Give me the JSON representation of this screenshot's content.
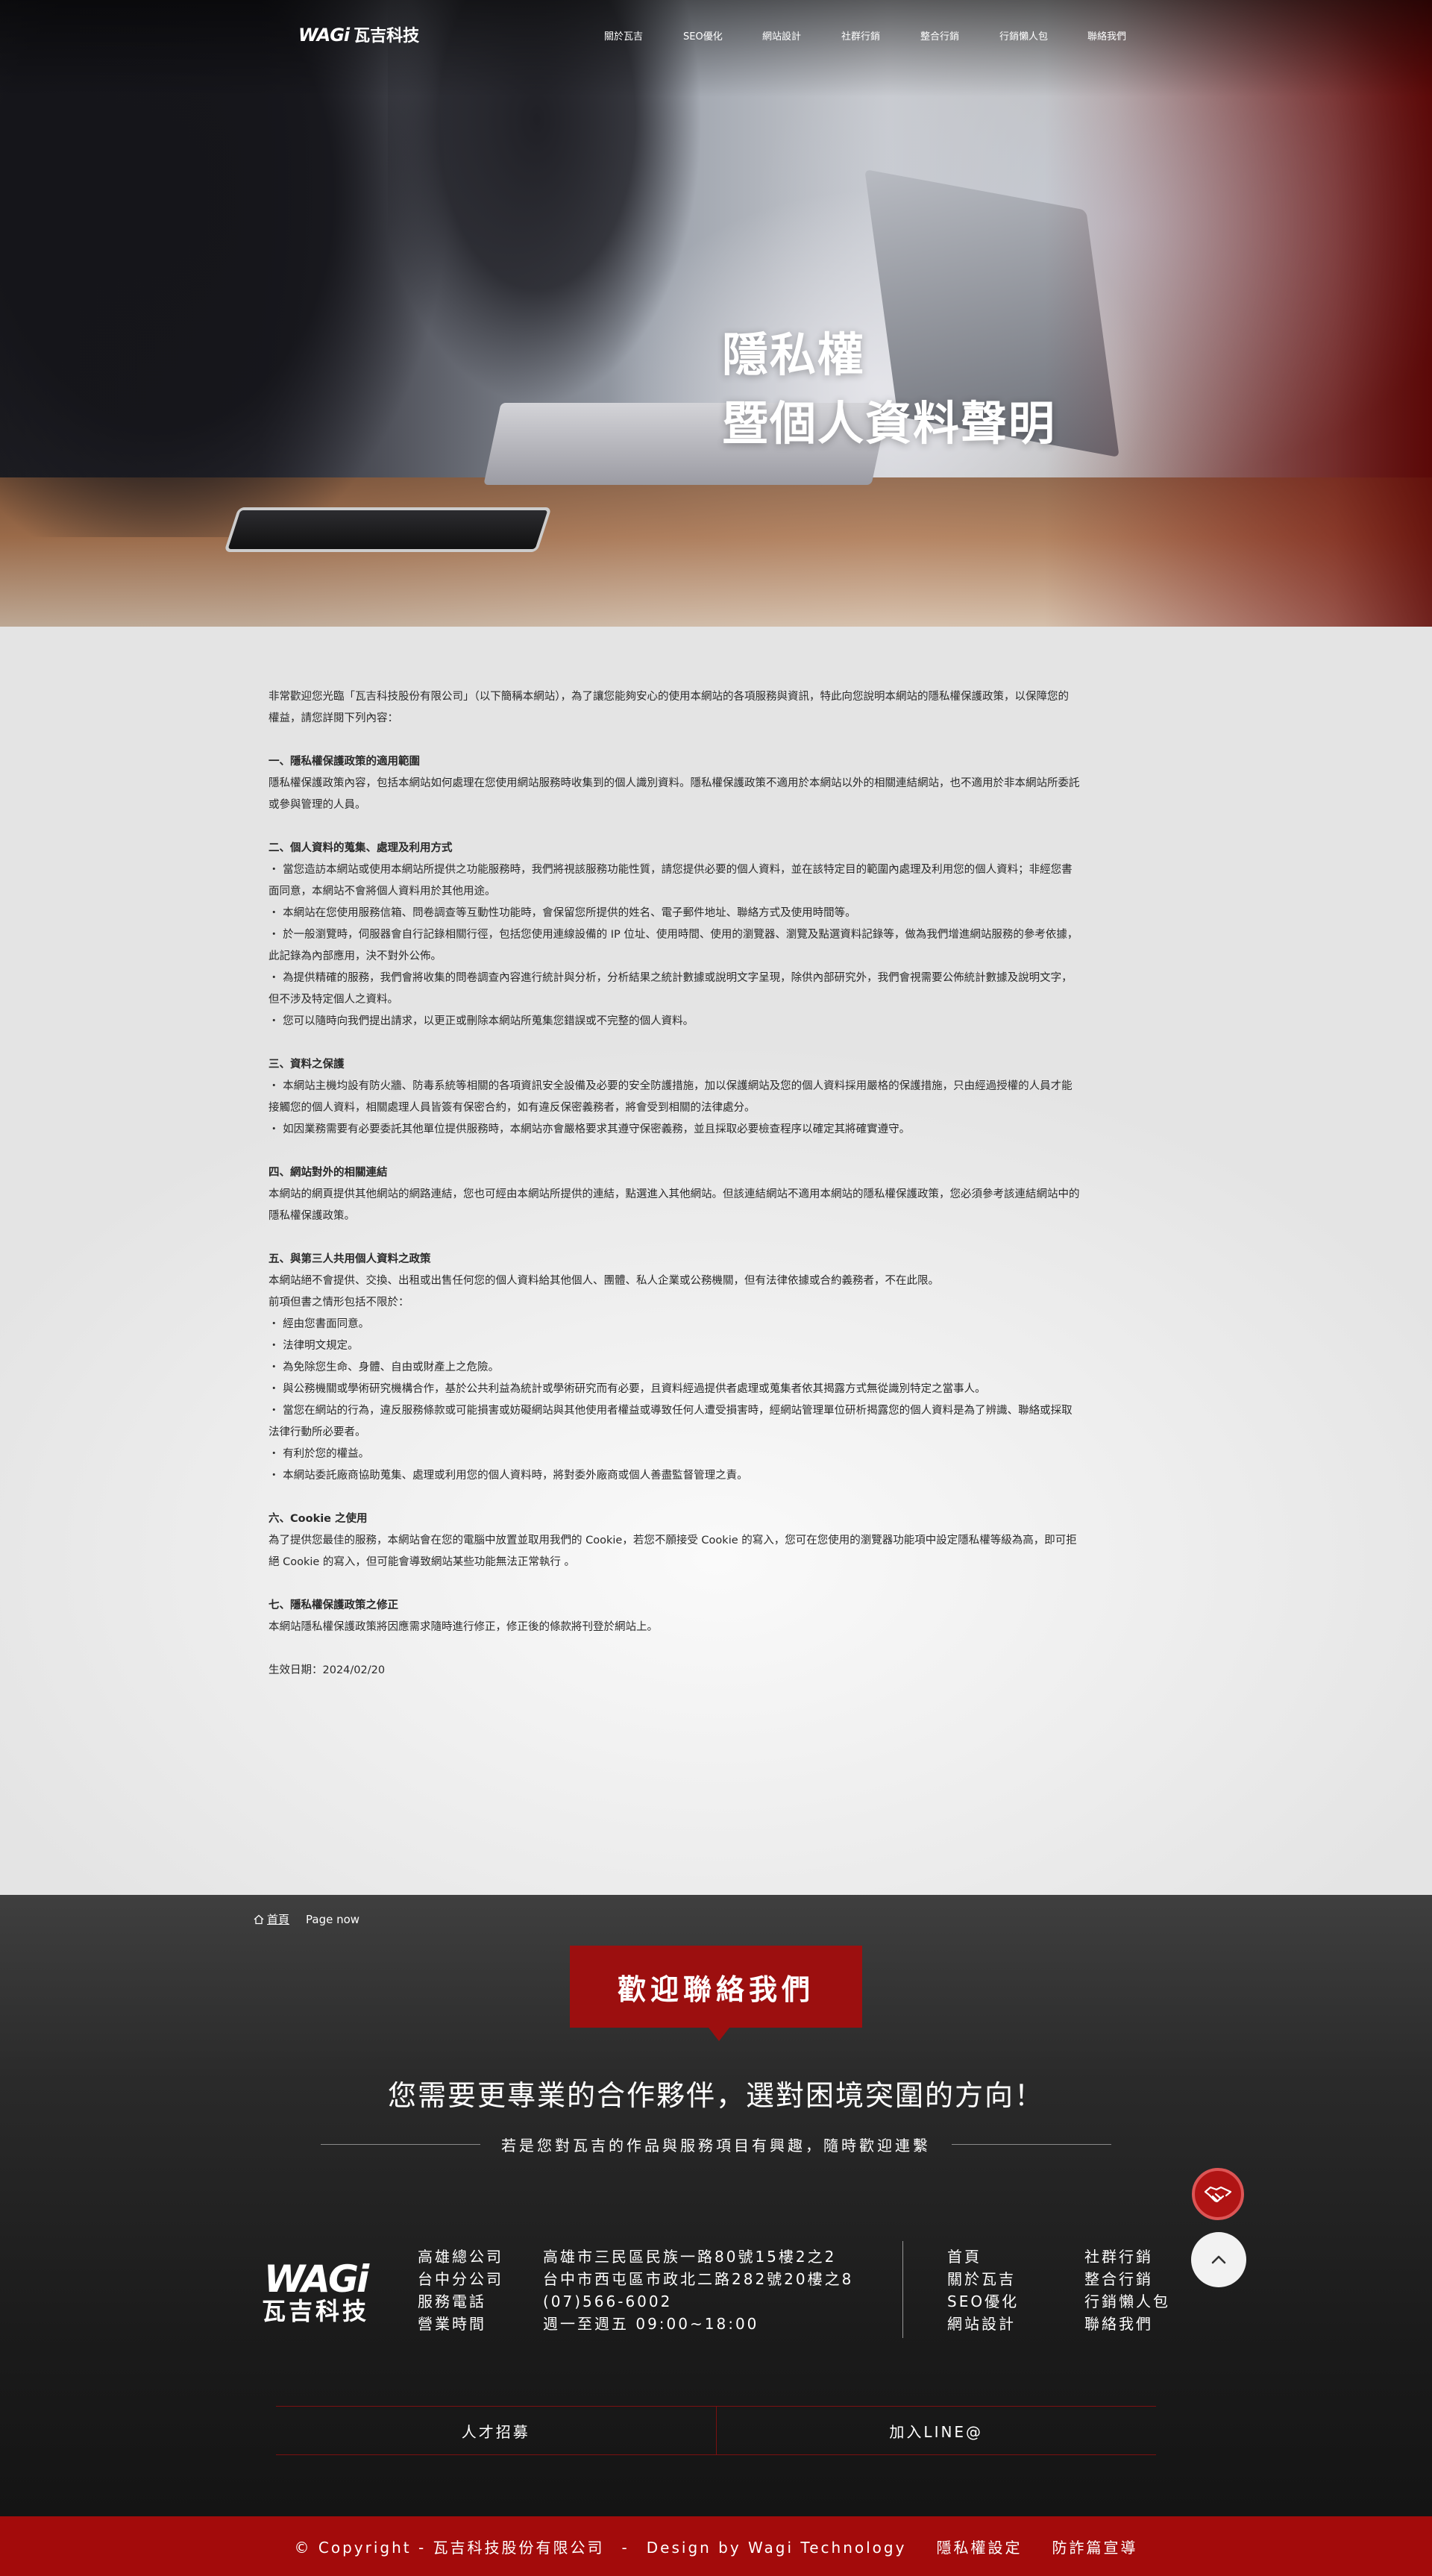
{
  "brand": {
    "wagi": "WAGi",
    "name_cn": "瓦吉科技"
  },
  "nav": {
    "items": [
      {
        "label": "關於瓦吉"
      },
      {
        "label": "SEO優化"
      },
      {
        "label": "網站設計"
      },
      {
        "label": "社群行銷"
      },
      {
        "label": "整合行銷"
      },
      {
        "label": "行銷懶人包"
      },
      {
        "label": "聯絡我們"
      }
    ]
  },
  "hero": {
    "title_line1": "隱私權",
    "title_line2": "暨個人資料聲明"
  },
  "article": {
    "intro": [
      "非常歡迎您光臨「瓦吉科技股份有限公司」（以下簡稱本網站），為了讓您能夠安心的使用本網站的各項服務與資訊，特此向您說明本網站的隱私權保護政策，以保障您的",
      "權益，請您詳閱下列內容："
    ],
    "s1_title": "一、隱私權保護政策的適用範圍",
    "s1": [
      "隱私權保護政策內容，包括本網站如何處理在您使用網站服務時收集到的個人識別資料。隱私權保護政策不適用於本網站以外的相關連結網站，也不適用於非本網站所委託",
      "或參與管理的人員。"
    ],
    "s2_title": "二、個人資料的蒐集、處理及利用方式",
    "s2": [
      "・ 當您造訪本網站或使用本網站所提供之功能服務時，我們將視該服務功能性質，請您提供必要的個人資料，並在該特定目的範圍內處理及利用您的個人資料；非經您書",
      "面同意，本網站不會將個人資料用於其他用途。",
      "・ 本網站在您使用服務信箱、問卷調查等互動性功能時，會保留您所提供的姓名、電子郵件地址、聯絡方式及使用時間等。",
      "・ 於一般瀏覽時，伺服器會自行記錄相關行徑，包括您使用連線設備的 IP 位址、使用時間、使用的瀏覽器、瀏覽及點選資料記錄等，做為我們增進網站服務的參考依據，",
      "此記錄為內部應用，決不對外公佈。",
      "・ 為提供精確的服務，我們會將收集的問卷調查內容進行統計與分析，分析結果之統計數據或說明文字呈現，除供內部研究外，我們會視需要公佈統計數據及說明文字，",
      "但不涉及特定個人之資料。",
      "・ 您可以隨時向我們提出請求，以更正或刪除本網站所蒐集您錯誤或不完整的個人資料。"
    ],
    "s3_title": "三、資料之保護",
    "s3": [
      "・ 本網站主機均設有防火牆、防毒系統等相關的各項資訊安全設備及必要的安全防護措施，加以保護網站及您的個人資料採用嚴格的保護措施，只由經過授權的人員才能",
      "接觸您的個人資料，相關處理人員皆簽有保密合約，如有違反保密義務者，將會受到相關的法律處分。",
      "・ 如因業務需要有必要委託其他單位提供服務時，本網站亦會嚴格要求其遵守保密義務，並且採取必要檢查程序以確定其將確實遵守。"
    ],
    "s4_title": "四、網站對外的相關連結",
    "s4": [
      "本網站的網頁提供其他網站的網路連結，您也可經由本網站所提供的連結，點選進入其他網站。但該連結網站不適用本網站的隱私權保護政策，您必須參考該連結網站中的",
      "隱私權保護政策。"
    ],
    "s5_title": "五、與第三人共用個人資料之政策",
    "s5": [
      "本網站絕不會提供、交換、出租或出售任何您的個人資料給其他個人、團體、私人企業或公務機關，但有法律依據或合約義務者，不在此限。",
      "前項但書之情形包括不限於：",
      "・ 經由您書面同意。",
      "・ 法律明文規定。",
      "・ 為免除您生命、身體、自由或財產上之危險。",
      "・ 與公務機關或學術研究機構合作，基於公共利益為統計或學術研究而有必要，且資料經過提供者處理或蒐集者依其揭露方式無從識別特定之當事人。",
      "・ 當您在網站的行為，違反服務條款或可能損害或妨礙網站與其他使用者權益或導致任何人遭受損害時，經網站管理單位研析揭露您的個人資料是為了辨識、聯絡或採取",
      "法律行動所必要者。",
      "・ 有利於您的權益。",
      "・ 本網站委託廠商協助蒐集、處理或利用您的個人資料時，將對委外廠商或個人善盡監督管理之責。"
    ],
    "s6_title": "六、Cookie 之使用",
    "s6": [
      "為了提供您最佳的服務，本網站會在您的電腦中放置並取用我們的 Cookie，若您不願接受 Cookie 的寫入，您可在您使用的瀏覽器功能項中設定隱私權等級為高，即可拒",
      "絕 Cookie 的寫入，但可能會導致網站某些功能無法正常執行 。"
    ],
    "s7_title": "七、隱私權保護政策之修正",
    "s7": [
      "本網站隱私權保護政策將因應需求隨時進行修正，修正後的條款將刊登於網站上。"
    ],
    "effective": "生效日期：2024/02/20"
  },
  "breadcrumb": {
    "home": "首頁",
    "current": "Page now"
  },
  "footer": {
    "contact_button": "歡迎聯絡我們",
    "slogan": "您需要更專業的合作夥伴，選對困境突圍的方向！",
    "sub_slogan": "若是您對瓦吉的作品與服務項目有興趣，隨時歡迎連繫",
    "info": [
      {
        "k": "高雄總公司",
        "v": "高雄市三民區民族一路80號15樓2之2"
      },
      {
        "k": "台中分公司",
        "v": "台中市西屯區市政北二路282號20樓之8"
      },
      {
        "k": "服務電話",
        "v": "(07)566-6002"
      },
      {
        "k": "營業時間",
        "v": "週一至週五 09:00~18:00"
      }
    ],
    "links": [
      "首頁",
      "社群行銷",
      "關於瓦吉",
      "整合行銷",
      "SEO優化",
      "行銷懶人包",
      "網站設計",
      "聯絡我們"
    ],
    "bar": {
      "left": "人才招募",
      "right": "加入LINE@"
    },
    "copyright": "© Copyright - 瓦吉科技股份有限公司　-　Design by Wagi Technology",
    "privacy": "隱私權設定",
    "anti_fraud": "防詐篇宣導"
  },
  "colors": {
    "accent": "#9c0f0f",
    "footer_bg": "#1b1b1b",
    "copyright_bg": "#a30b0b"
  },
  "icons": {
    "chat": "handshake-icon",
    "top": "chevron-up-icon",
    "home": "home-icon"
  }
}
